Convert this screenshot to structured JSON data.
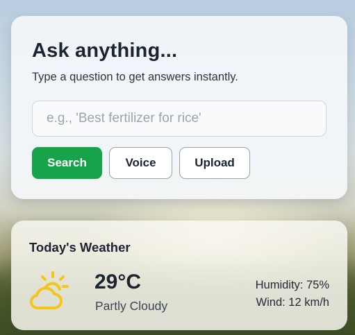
{
  "ask": {
    "title": "Ask anything...",
    "subtitle": "Type a question to get answers instantly.",
    "input_placeholder": "e.g., 'Best fertilizer for rice'",
    "input_value": "",
    "buttons": {
      "search": "Search",
      "voice": "Voice",
      "upload": "Upload"
    }
  },
  "weather": {
    "title": "Today's Weather",
    "icon": "partly-cloudy-icon",
    "temperature": "29°C",
    "condition": "Partly Cloudy",
    "humidity": "Humidity: 75%",
    "wind": "Wind: 12 km/h"
  },
  "colors": {
    "accent": "#16a34a",
    "icon_yellow": "#f5c518",
    "text_dark": "#1b2430"
  }
}
